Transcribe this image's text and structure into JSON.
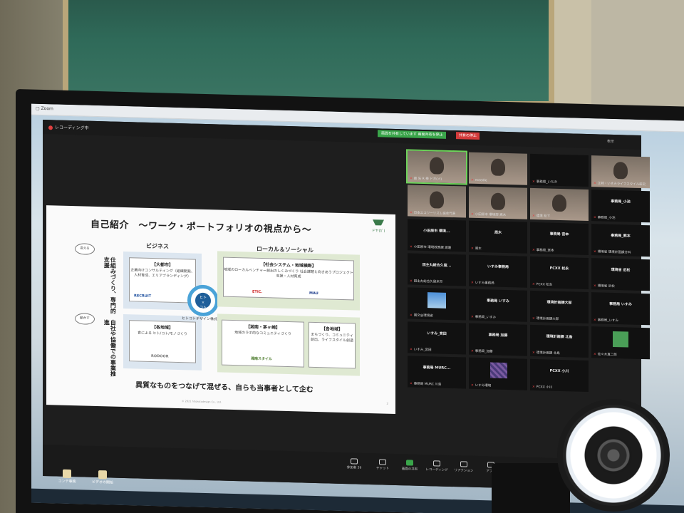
{
  "zoom": {
    "recording": "レコーディング中",
    "share_banner": "画面を共有しています 画面共有を停止",
    "share_stop": "共有の停止",
    "view": "表示",
    "toolbar": [
      {
        "label": "参加者",
        "count": "39"
      },
      {
        "label": "チャット"
      },
      {
        "label": "画面の共有"
      },
      {
        "label": "レコーディング"
      },
      {
        "label": "リアクション"
      },
      {
        "label": "アプリ"
      }
    ]
  },
  "slide": {
    "title": "自己紹介　～ワーク・ポートフォリオの視点から～",
    "logo": "ドヤ(ｶﾞ)",
    "col_business": "ビジネス",
    "col_local": "ローカル＆ソーシャル",
    "bubble_top": "変える",
    "bubble_bottom": "動かす",
    "side_top": "仕組みづくり、専門的支援",
    "side_bottom": "自社や協働での事業推進",
    "box1_title": "【大都市】",
    "box1_body": "企業向けコンサルティング（組織開発、人材育成、エリアブランディング）",
    "box1_logo": "RECRUIT",
    "box2_title": "【各地域】",
    "box2_body": "食による ヒト/コト/モノづくり",
    "box2_logo": "RODOOR",
    "box3_title": "【社会システム・地域横断】",
    "box3_body": "地域のローカルベンチャー創出のしくみづくり 社会課題と向きあうプロジェクト支援・人材育成",
    "box3_logo_a": "ETIC.",
    "box3_logo_b": "MAU",
    "box4_title": "【湘南・茅ヶ崎】",
    "box4_body": "地域のラボ的なコミュニティづくり",
    "box4_logo": "湘南スタイル",
    "box5_title": "【各地域】",
    "box5_body": "まちづくり、コミュニティ創出、ライフスタイル創造",
    "center_line1": "ヒト",
    "center_line2": "×",
    "center_line3": "コト",
    "center_label": "ヒトコトデザイン株式会社",
    "bottom": "異質なものをつなげて混ぜる、自らも当事者として企む",
    "copyright": "© 2021 hitokotodesign Co., Ltd.",
    "page": "2"
  },
  "gallery": [
    {
      "name": "最 矢 R 様 ドガ(ﾝﾀ)",
      "kind": "video"
    },
    {
      "name": "meedie",
      "kind": "video"
    },
    {
      "name": "事務局_いちき",
      "kind": "name"
    },
    {
      "name": "江崎・いすみライフスタイル研究",
      "kind": "video"
    },
    {
      "name": "日本エコツーリズム協会代表",
      "kind": "video"
    },
    {
      "name": "小田原市 環境部 高木",
      "kind": "video"
    },
    {
      "name": "環境 松下",
      "kind": "video"
    },
    {
      "name": "事務局_小池",
      "kind": "name",
      "big": "事務局_小池"
    },
    {
      "name": "小田原市 環境政策課 渡邊",
      "kind": "name",
      "big": "小田原市 環境..."
    },
    {
      "name": "周木",
      "kind": "name",
      "big": "周木"
    },
    {
      "name": "事務局_宮本",
      "kind": "name",
      "big": "事務局 宮本"
    },
    {
      "name": "環境省 環境計画課分科",
      "kind": "name",
      "big": "事務局_熊本"
    },
    {
      "name": "田主丸総合久留米市",
      "kind": "name",
      "big": "田主丸総合久留..."
    },
    {
      "name": "いすみ事務局",
      "kind": "name",
      "big": "いすみ事務局"
    },
    {
      "name": "PCXX 松永",
      "kind": "name",
      "big": "PCXX 松永"
    },
    {
      "name": "環境省 近松",
      "kind": "name",
      "big": "環境省 近松"
    },
    {
      "name": "国文@環境省",
      "kind": "sky"
    },
    {
      "name": "事務局_いすみ",
      "kind": "name",
      "big": "事務局 いすみ"
    },
    {
      "name": "環境計画課大部",
      "kind": "name",
      "big": "環境計画課大部"
    },
    {
      "name": "事務局_いすみ",
      "kind": "name",
      "big": "事務局 いすみ"
    },
    {
      "name": "いすみ_宮田",
      "kind": "name",
      "big": "いすみ_宮田"
    },
    {
      "name": "事務局_加藤",
      "kind": "name",
      "big": "事務局 加藤"
    },
    {
      "name": "環境計画課 北島",
      "kind": "name",
      "big": "環境計画課 北島"
    },
    {
      "name": "佐々木真二郎",
      "kind": "avatar"
    },
    {
      "name": "事務局 MURC 川島",
      "kind": "name",
      "big": "事務局 MURC..."
    },
    {
      "name": "いすみ環境",
      "kind": "pattern"
    },
    {
      "name": "PCXX 小川",
      "kind": "name",
      "big": "PCXX 小川"
    }
  ],
  "desktop": {
    "icon1": "コンテ事務",
    "icon2": "ビデオの開始"
  }
}
